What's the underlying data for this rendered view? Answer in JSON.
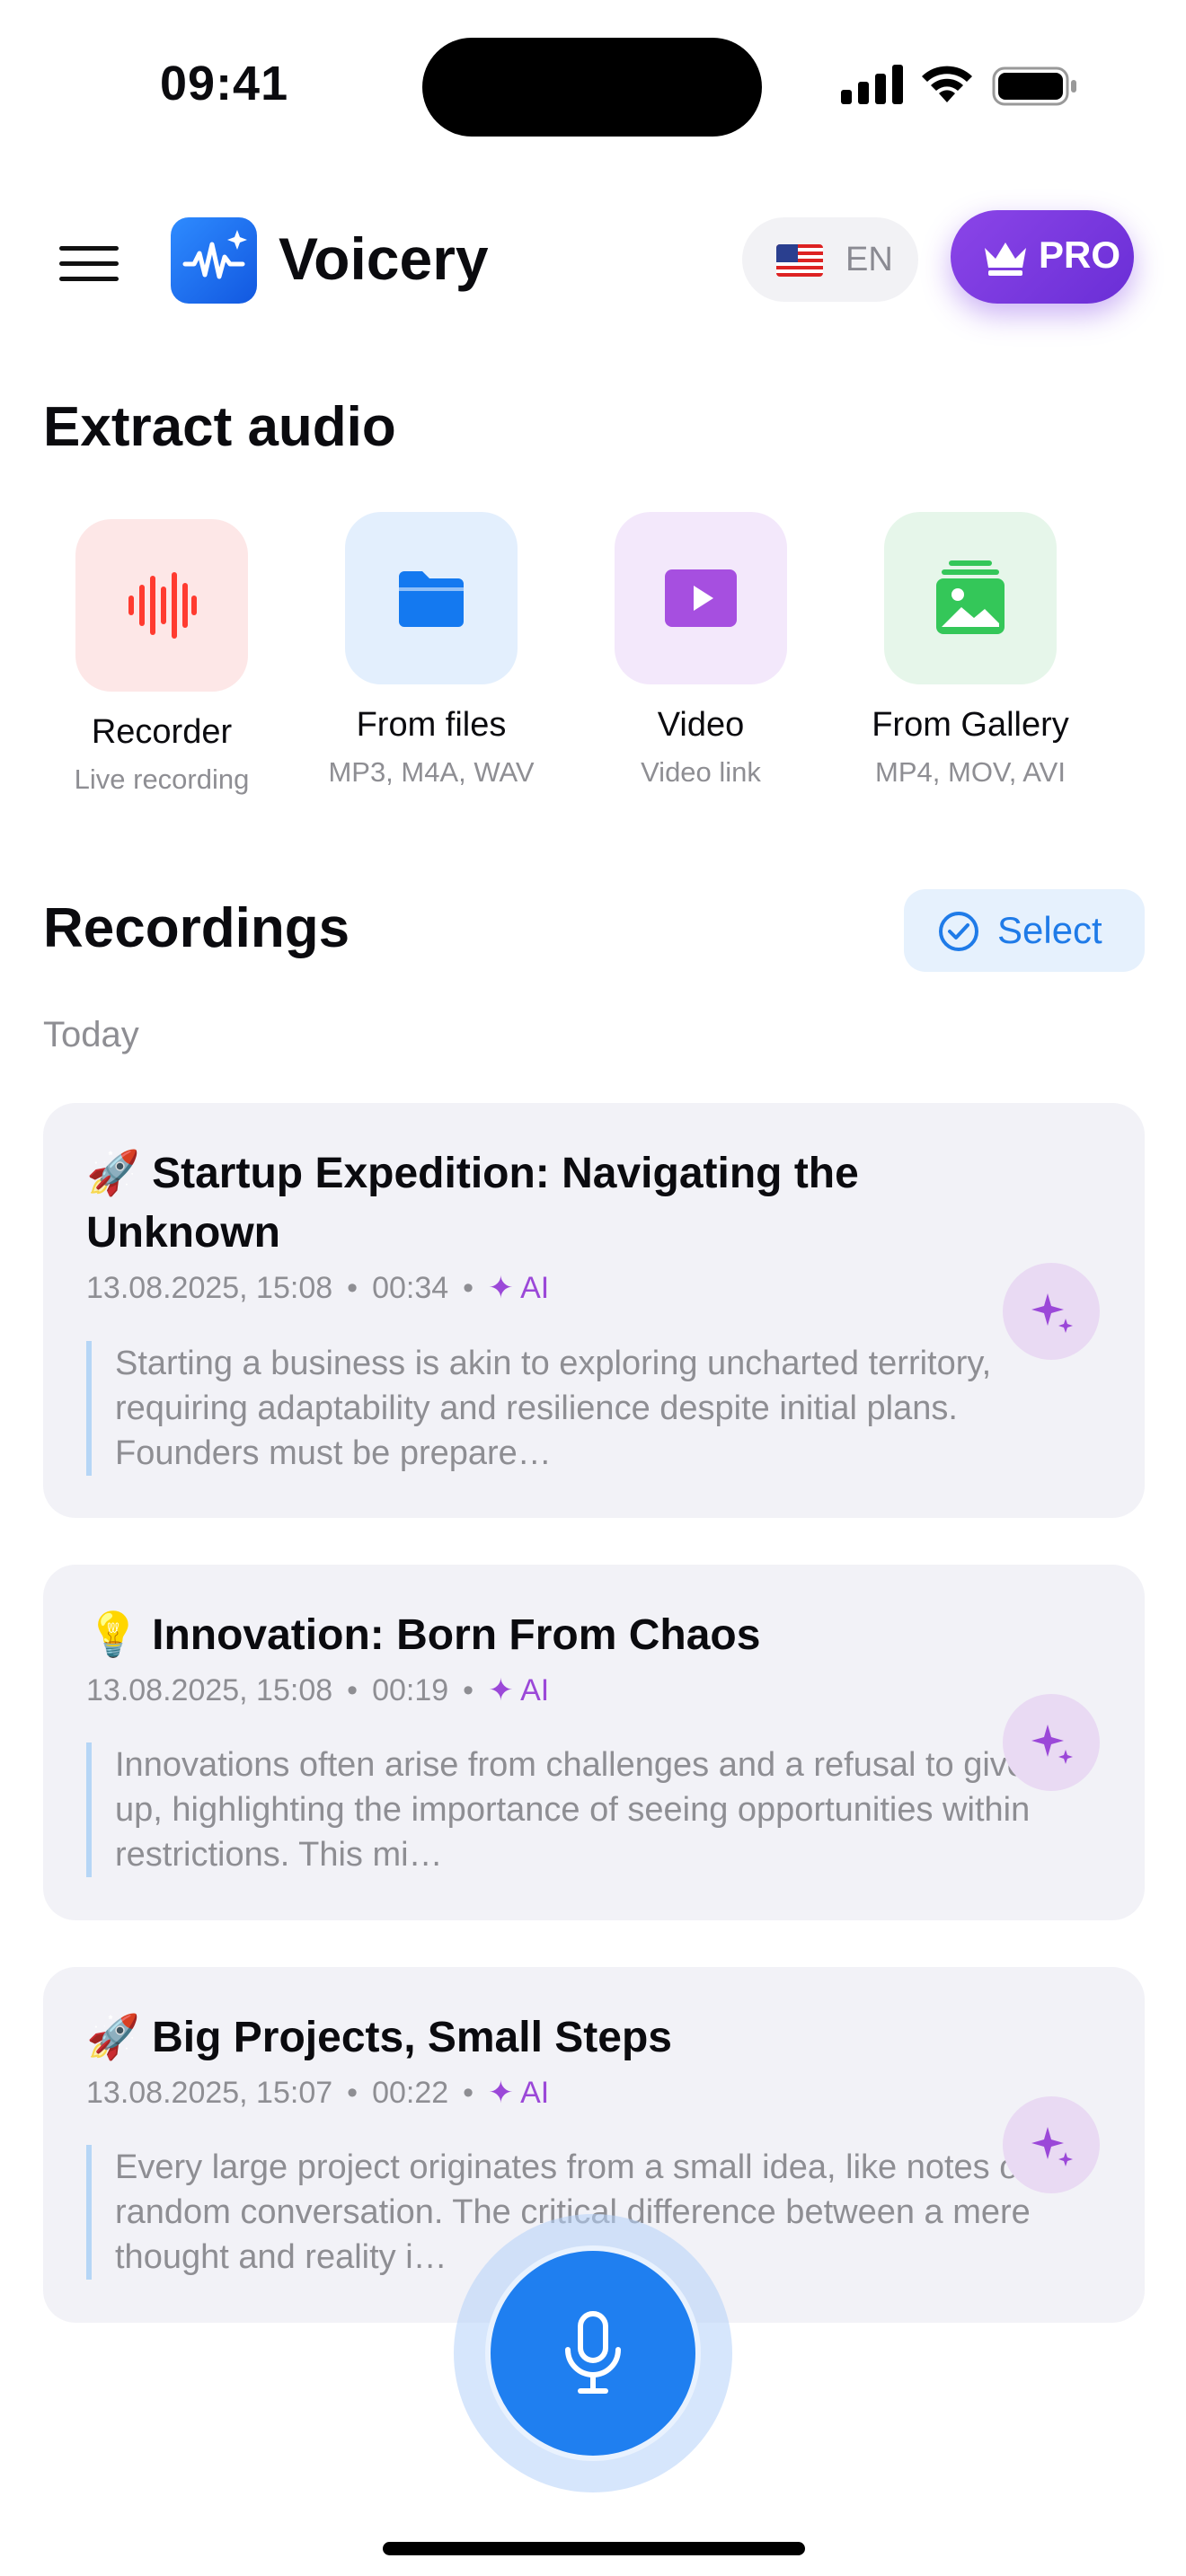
{
  "status": {
    "time": "09:41"
  },
  "header": {
    "app_title": "Voicery",
    "lang": "EN",
    "pro_label": "PRO"
  },
  "extract": {
    "title": "Extract audio",
    "tiles": [
      {
        "name": "Recorder",
        "sub": "Live recording",
        "icon": "waveform-icon",
        "color": "#ff3b30"
      },
      {
        "name": "From files",
        "sub": "MP3, M4A, WAV",
        "icon": "folder-icon",
        "color": "#1479f0"
      },
      {
        "name": "Video",
        "sub": "Video link",
        "icon": "play-icon",
        "color": "#a64fe0"
      },
      {
        "name": "From Gallery",
        "sub": "MP4, MOV, AVI",
        "icon": "photo-stack-icon",
        "color": "#34c759"
      }
    ]
  },
  "recordings": {
    "title": "Recordings",
    "select_label": "Select",
    "group_label": "Today",
    "items": [
      {
        "emoji": "🚀",
        "title": "Startup Expedition: Navigating the Unknown",
        "date": "13.08.2025, 15:08",
        "duration": "00:34",
        "ai_label": "AI",
        "preview": "Starting a business is akin to exploring uncharted territory, requiring adaptability and resilience despite initial plans. Founders must be prepare…"
      },
      {
        "emoji": "💡",
        "title": "Innovation: Born From Chaos",
        "date": "13.08.2025, 15:08",
        "duration": "00:19",
        "ai_label": "AI",
        "preview": "Innovations often arise from challenges and a refusal to give up, highlighting the importance of seeing opportunities within restrictions. This mi…"
      },
      {
        "emoji": "🚀",
        "title": "Big Projects, Small Steps",
        "date": "13.08.2025, 15:07",
        "duration": "00:22",
        "ai_label": "AI",
        "preview": "Every large project originates from a small idea, like notes or a random conversation. The critical difference between a mere thought and reality i…"
      }
    ]
  }
}
